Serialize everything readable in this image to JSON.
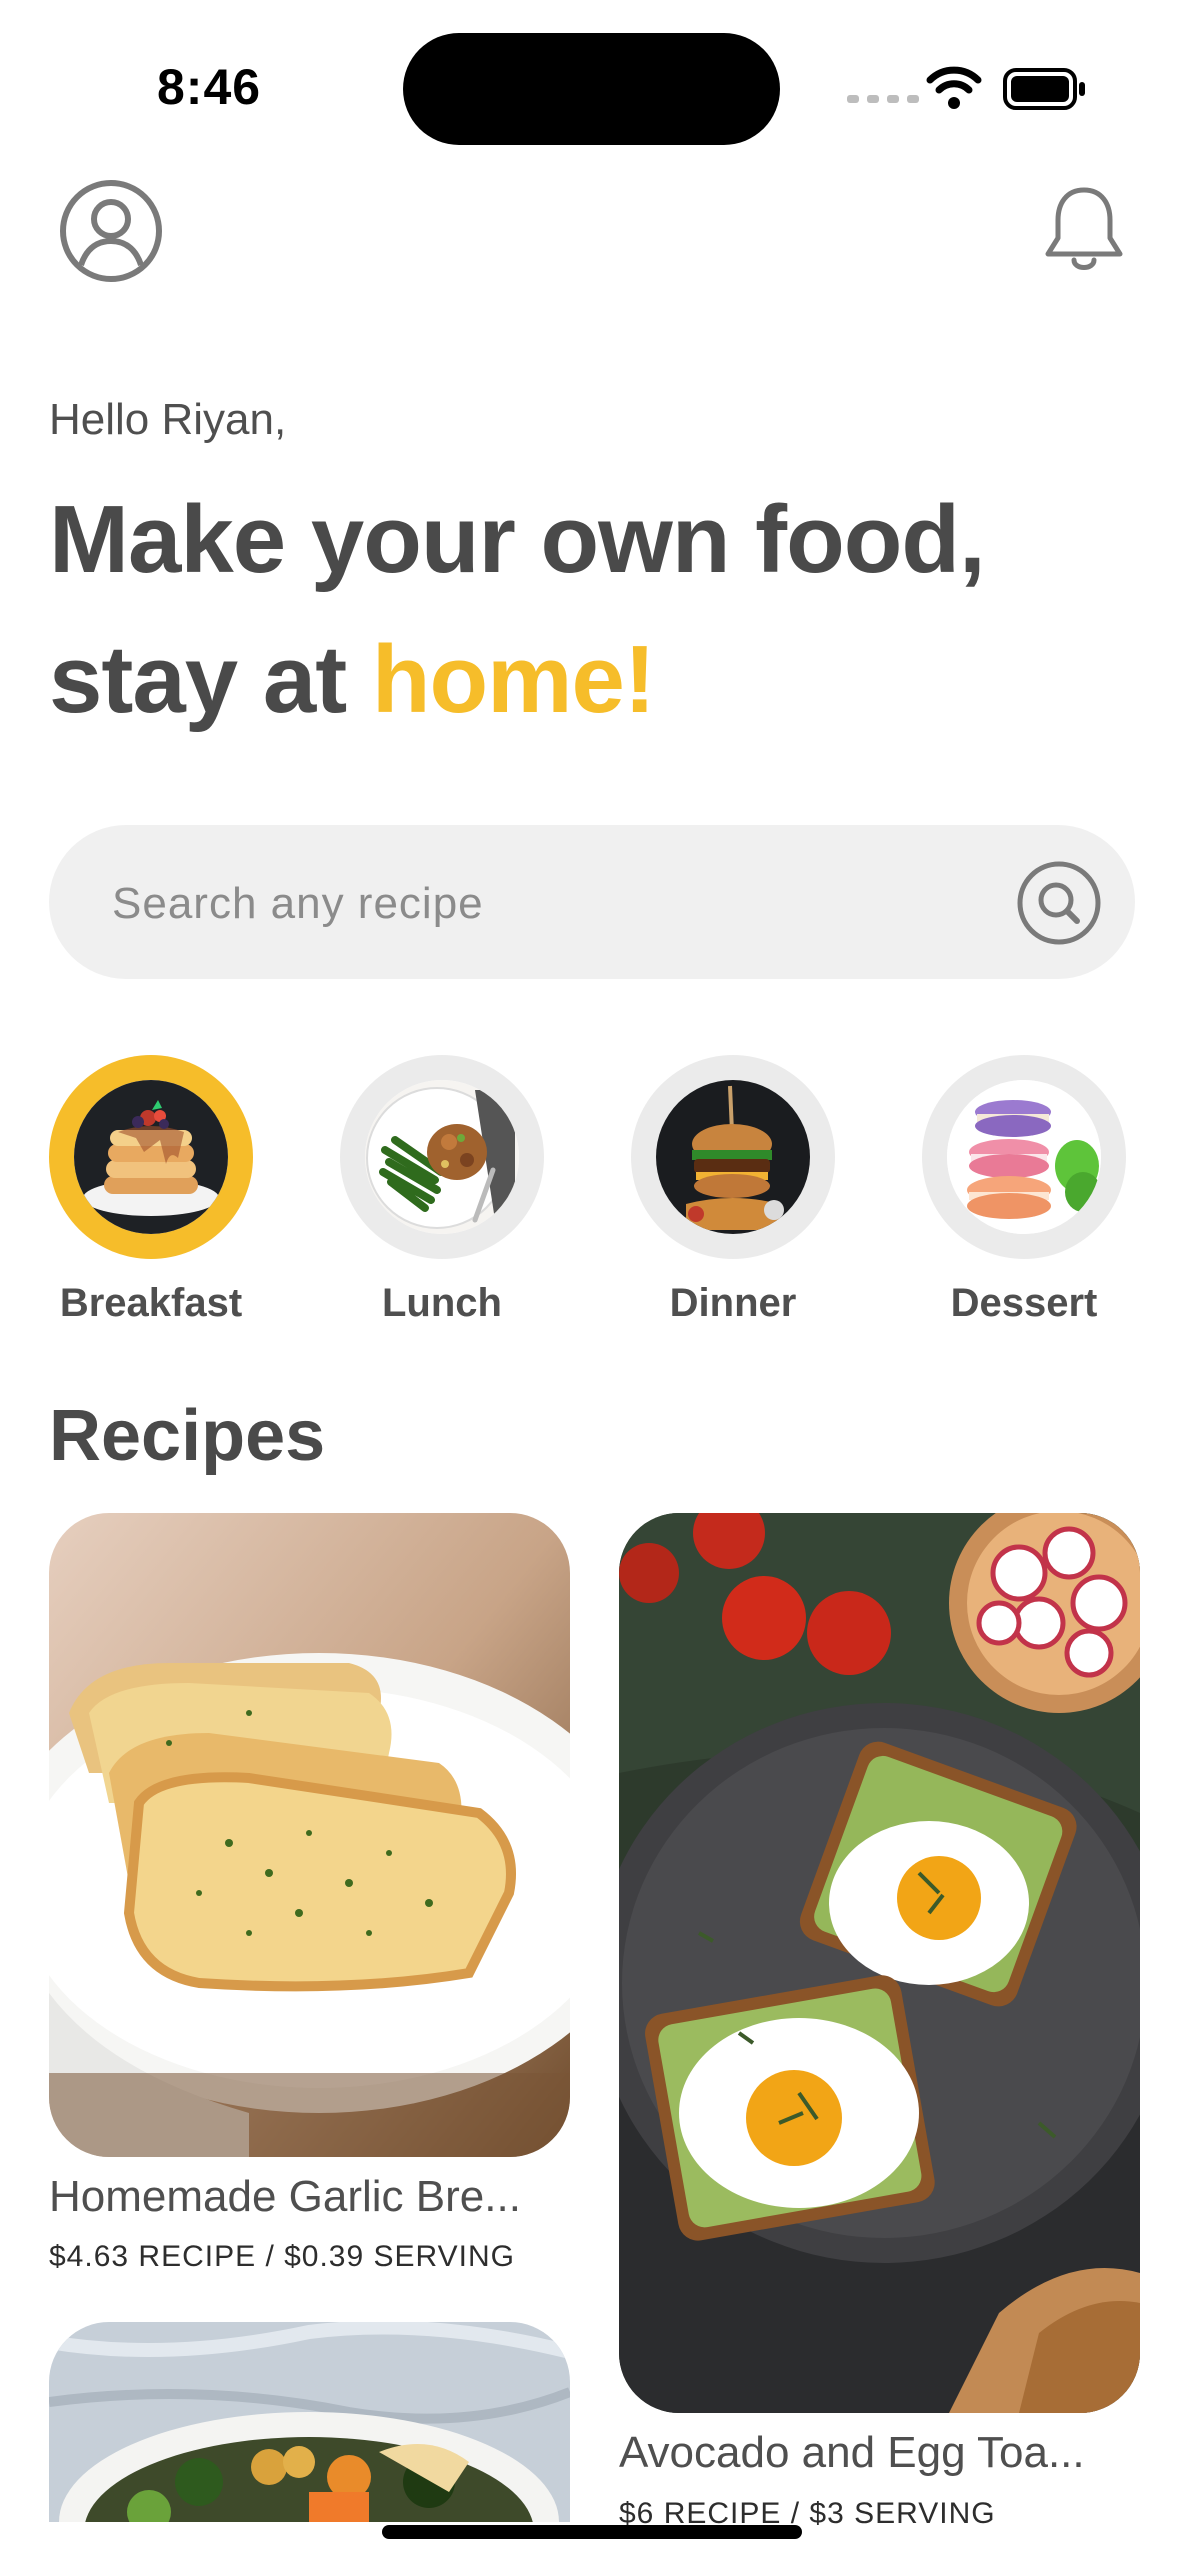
{
  "status_bar": {
    "time": "8:46"
  },
  "header": {
    "profile_icon": "person-circle-icon",
    "notification_icon": "bell-icon"
  },
  "greeting": {
    "hello": "Hello Riyan,",
    "headline_line1": "Make your own food,",
    "headline_line2_prefix": "stay at ",
    "headline_line2_accent": "home!",
    "accent_color": "#f6bd2a"
  },
  "search": {
    "placeholder": "Search any recipe",
    "icon": "search-icon"
  },
  "categories": [
    {
      "label": "Breakfast",
      "selected": true
    },
    {
      "label": "Lunch",
      "selected": false
    },
    {
      "label": "Dinner",
      "selected": false
    },
    {
      "label": "Dessert",
      "selected": false
    }
  ],
  "recipes_section": {
    "title": "Recipes"
  },
  "recipes": [
    {
      "title": "Homemade Garlic Bre...",
      "price": "$4.63 RECIPE / $0.39 SERVING"
    },
    {
      "title": "Avocado and Egg Toa...",
      "price": "$6 RECIPE / $3 SERVING"
    },
    {
      "title": "",
      "price": ""
    }
  ]
}
